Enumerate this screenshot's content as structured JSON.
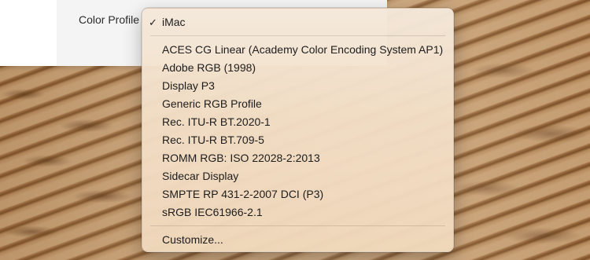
{
  "settings": {
    "color_profile_label": "Color Profile"
  },
  "menu": {
    "selected": {
      "checkmark": "✓",
      "label": "iMac"
    },
    "items": [
      "ACES CG Linear (Academy Color Encoding System AP1)",
      "Adobe RGB (1998)",
      "Display P3",
      "Generic RGB Profile",
      "Rec. ITU-R BT.2020-1",
      "Rec. ITU-R BT.709-5",
      "ROMM RGB: ISO 22028-2:2013",
      "Sidecar Display",
      "SMPTE RP 431-2-2007 DCI (P3)",
      "sRGB IEC61966-2.1"
    ],
    "customize_label": "Customize..."
  }
}
